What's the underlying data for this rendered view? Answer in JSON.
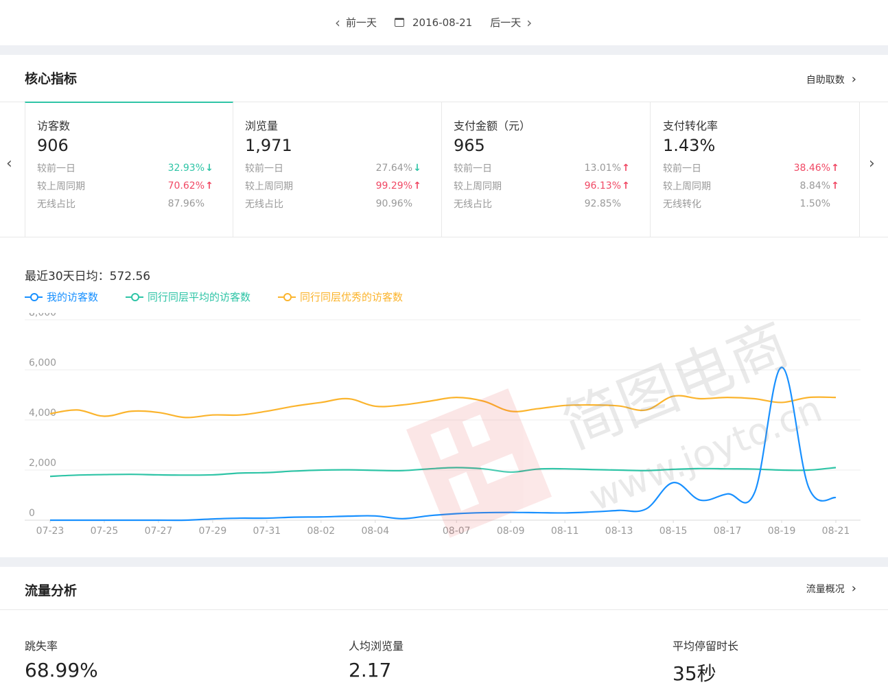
{
  "datenav": {
    "prev": "前一天",
    "date": "2016-08-21",
    "next": "后一天"
  },
  "core": {
    "title": "核心指标",
    "link": "自助取数",
    "cards": [
      {
        "title": "访客数",
        "value": "906",
        "rows": [
          {
            "label": "较前一日",
            "value": "32.93%",
            "trend": "down"
          },
          {
            "label": "较上周同期",
            "value": "70.62%",
            "trend": "up"
          },
          {
            "label": "无线占比",
            "value": "87.96%",
            "trend": "none"
          }
        ]
      },
      {
        "title": "浏览量",
        "value": "1,971",
        "rows": [
          {
            "label": "较前一日",
            "value": "27.64%",
            "trend": "down-muted"
          },
          {
            "label": "较上周同期",
            "value": "99.29%",
            "trend": "up"
          },
          {
            "label": "无线占比",
            "value": "90.96%",
            "trend": "none"
          }
        ]
      },
      {
        "title": "支付金额（元）",
        "value": "965",
        "rows": [
          {
            "label": "较前一日",
            "value": "13.01%",
            "trend": "up-muted"
          },
          {
            "label": "较上周同期",
            "value": "96.13%",
            "trend": "up"
          },
          {
            "label": "无线占比",
            "value": "92.85%",
            "trend": "none"
          }
        ]
      },
      {
        "title": "支付转化率",
        "value": "1.43%",
        "rows": [
          {
            "label": "较前一日",
            "value": "38.46%",
            "trend": "up"
          },
          {
            "label": "较上周同期",
            "value": "8.84%",
            "trend": "up-muted"
          },
          {
            "label": "无线转化",
            "value": "1.50%",
            "trend": "none"
          }
        ]
      }
    ]
  },
  "avg_text": "最近30天日均：572.56",
  "colors": {
    "mine": "#1890ff",
    "avg": "#2ec4a6",
    "best": "#fbb42d",
    "up": "#f04864",
    "down": "#2ec4a6"
  },
  "chart_data": {
    "type": "line",
    "ylim": [
      0,
      8000
    ],
    "yticks": [
      "8,000",
      "6,000",
      "4,000",
      "2,000",
      "0"
    ],
    "ytick_values": [
      8000,
      6000,
      4000,
      2000,
      0
    ],
    "xtick_labels": [
      "07-23",
      "07-25",
      "07-27",
      "07-29",
      "07-31",
      "08-02",
      "08-04",
      "08-07",
      "08-09",
      "08-11",
      "08-13",
      "08-15",
      "08-17",
      "08-19",
      "08-21"
    ],
    "xtick_dates": [
      "07-23",
      "07-25",
      "07-27",
      "07-29",
      "07-31",
      "08-02",
      "08-04",
      "08-07",
      "08-09",
      "08-11",
      "08-13",
      "08-15",
      "08-17",
      "08-19",
      "08-21"
    ],
    "x": [
      "07-23",
      "07-24",
      "07-25",
      "07-26",
      "07-27",
      "07-28",
      "07-29",
      "07-30",
      "07-31",
      "08-01",
      "08-02",
      "08-03",
      "08-04",
      "08-05",
      "08-06",
      "08-07",
      "08-08",
      "08-09",
      "08-10",
      "08-11",
      "08-12",
      "08-13",
      "08-14",
      "08-15",
      "08-16",
      "08-17",
      "08-18",
      "08-19",
      "08-20",
      "08-21"
    ],
    "series": [
      {
        "name": "我的访客数",
        "color": "#1890ff",
        "values": [
          0,
          0,
          0,
          0,
          0,
          0,
          50,
          80,
          80,
          120,
          130,
          160,
          170,
          60,
          180,
          260,
          300,
          310,
          300,
          290,
          330,
          390,
          450,
          1500,
          800,
          1050,
          1100,
          6100,
          1300,
          900
        ]
      },
      {
        "name": "同行同层平均的访客数",
        "color": "#2ec4a6",
        "values": [
          1750,
          1800,
          1820,
          1830,
          1810,
          1800,
          1810,
          1880,
          1900,
          1960,
          2000,
          2010,
          1990,
          1980,
          2050,
          2100,
          2050,
          1920,
          2040,
          2050,
          2020,
          2000,
          1980,
          2030,
          2060,
          2050,
          2040,
          2000,
          2000,
          2100
        ]
      },
      {
        "name": "同行同层优秀的访客数",
        "color": "#fbb42d",
        "values": [
          4250,
          4400,
          4150,
          4350,
          4300,
          4100,
          4200,
          4200,
          4350,
          4550,
          4700,
          4850,
          4550,
          4600,
          4750,
          4900,
          4750,
          4350,
          4450,
          4580,
          4600,
          4560,
          4400,
          4950,
          4850,
          4900,
          4850,
          4700,
          4900,
          4900
        ]
      }
    ]
  },
  "traffic": {
    "title": "流量分析",
    "link": "流量概况",
    "stats": [
      {
        "label": "跳失率",
        "value": "68.99%"
      },
      {
        "label": "人均浏览量",
        "value": "2.17"
      },
      {
        "label": "平均停留时长",
        "value": "35秒"
      }
    ]
  },
  "watermark": {
    "cn": "简图电商",
    "url": "www.joyto.cn"
  }
}
